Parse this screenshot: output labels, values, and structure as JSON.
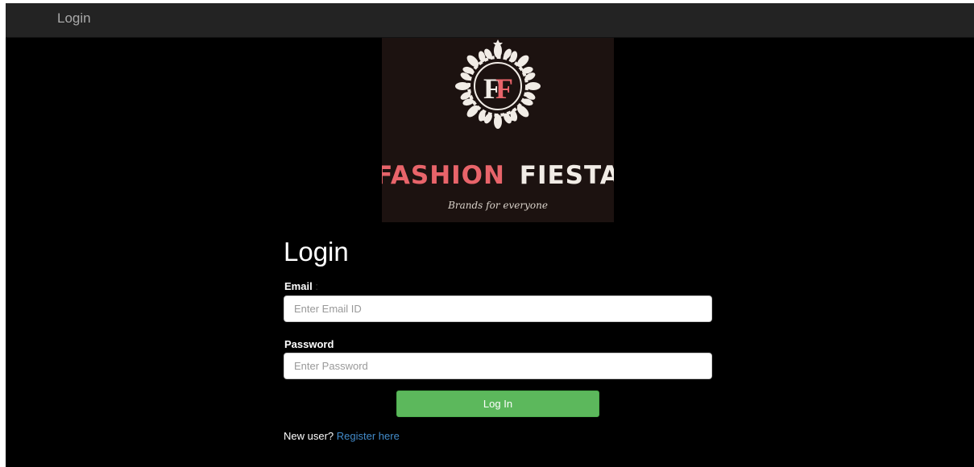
{
  "navbar": {
    "brand_label": "Login"
  },
  "logo": {
    "brand_name_part1": "FASHION",
    "brand_name_part2": "FIESTA",
    "tagline": "Brands for everyone",
    "monogram": "FF"
  },
  "form": {
    "heading": "Login",
    "email": {
      "label": "Email",
      "label_suffix": ":",
      "placeholder": "Enter Email ID",
      "value": ""
    },
    "password": {
      "label": "Password",
      "placeholder": "Enter Password",
      "value": ""
    },
    "submit_label": "Log In",
    "register_prompt": "New user?",
    "register_link": "Register here"
  },
  "colors": {
    "page_background": "#000000",
    "navbar_background": "#232323",
    "submit_button": "#5cb85c",
    "link": "#428bca",
    "logo_accent": "#e8646a"
  }
}
